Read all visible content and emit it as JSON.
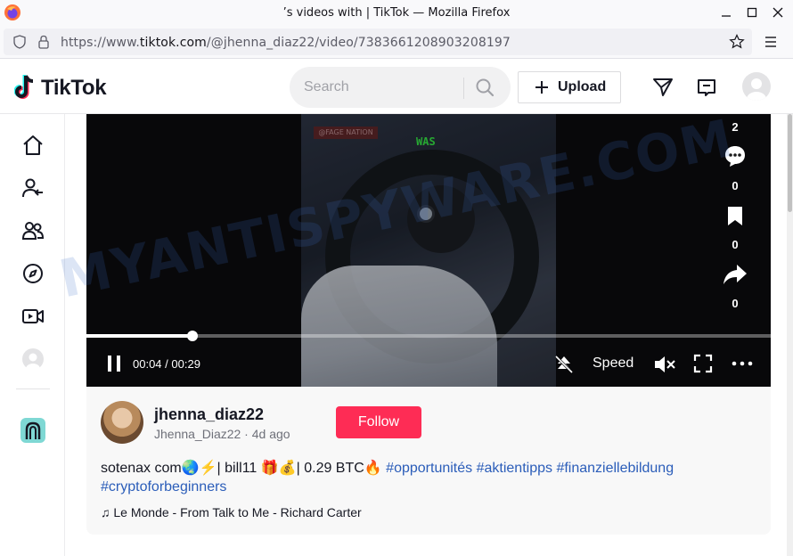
{
  "browser": {
    "window_title": "’s videos with | TikTok — Mozilla Firefox",
    "url_prefix": "https://www.",
    "url_domain": "tiktok.com",
    "url_path": "/@jhenna_diaz22/video/7383661208903208197"
  },
  "header": {
    "logo_text": "TikTok",
    "search_placeholder": "Search",
    "upload_label": "Upload"
  },
  "video": {
    "overlay_tag": "@FAGE NATION",
    "overlay_caption": "WAS",
    "current_time": "00:04",
    "duration": "00:29",
    "time_separator": " / ",
    "progress_fraction": 0.155,
    "speed_label": "Speed",
    "actions": [
      {
        "icon": "like-icon",
        "count": "2"
      },
      {
        "icon": "comment-icon",
        "count": "0"
      },
      {
        "icon": "bookmark-icon",
        "count": "0"
      },
      {
        "icon": "share-icon",
        "count": "0"
      }
    ]
  },
  "author": {
    "username": "jhenna_diaz22",
    "display_name": "Jhenna_Diaz22",
    "separator": " · ",
    "posted": "4d ago",
    "follow_label": "Follow"
  },
  "description": {
    "text": "sotenax com🌏⚡| bill11 🎁💰| 0.29 BTC🔥 ",
    "hashtags": [
      "#opportunités",
      "#aktientipps",
      "#finanziellebildung",
      "#cryptoforbeginners"
    ]
  },
  "music": {
    "icon": "music-note-icon",
    "title": "Le Monde - From Talk to Me - Richard Carter"
  },
  "watermark": "MYANTISPYWARE.COM",
  "colors": {
    "follow": "#fe2c55",
    "hashtag": "#2b5db9",
    "text": "#161823"
  }
}
